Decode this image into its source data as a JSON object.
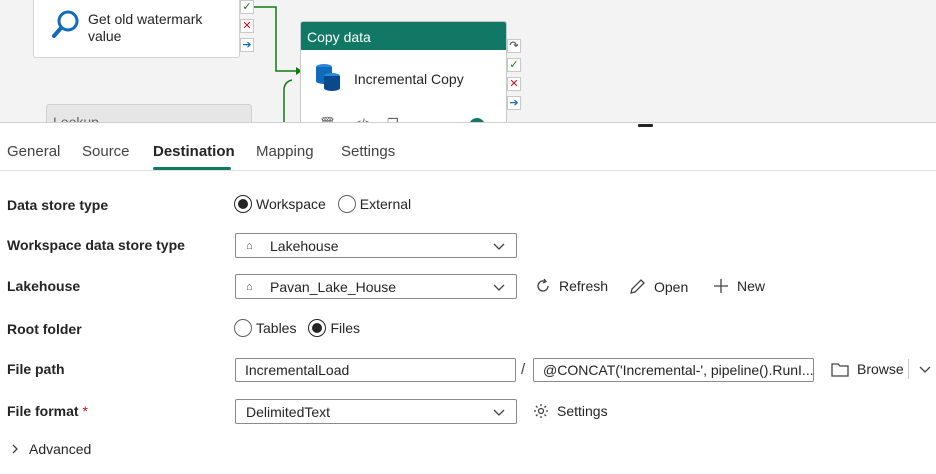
{
  "canvas": {
    "lookup_activity_label": "Get old watermark value",
    "lookup_partial_label": "Lookup",
    "copy_activity": {
      "header": "Copy data",
      "name": "Incremental Copy",
      "header_color": "#117865"
    },
    "status_icons": [
      "success-check-icon",
      "failure-x-icon",
      "completion-arrow-icon",
      "skip-icon"
    ]
  },
  "tabs": [
    {
      "label": "General",
      "active": false
    },
    {
      "label": "Source",
      "active": false
    },
    {
      "label": "Destination",
      "active": true
    },
    {
      "label": "Mapping",
      "active": false
    },
    {
      "label": "Settings",
      "active": false
    }
  ],
  "form": {
    "data_store_type": {
      "label": "Data store type",
      "options": [
        {
          "label": "Workspace",
          "selected": true
        },
        {
          "label": "External",
          "selected": false
        }
      ]
    },
    "workspace_data_store_type": {
      "label": "Workspace data store type",
      "value": "Lakehouse",
      "icon": "lakehouse-icon"
    },
    "lakehouse": {
      "label": "Lakehouse",
      "value": "Pavan_Lake_House",
      "icon": "lakehouse-icon",
      "actions": {
        "refresh": "Refresh",
        "open": "Open",
        "new": "New"
      }
    },
    "root_folder": {
      "label": "Root folder",
      "options": [
        {
          "label": "Tables",
          "selected": false
        },
        {
          "label": "Files",
          "selected": true
        }
      ]
    },
    "file_path": {
      "label": "File path",
      "directory": "IncrementalLoad",
      "separator": "/",
      "file_name": "@CONCAT('Incremental-', pipeline().RunI...",
      "browse_label": "Browse"
    },
    "file_format": {
      "label": "File format",
      "required_marker": "*",
      "value": "DelimitedText",
      "settings_label": "Settings"
    },
    "advanced_label": "Advanced"
  },
  "colors": {
    "accent": "#117865",
    "success": "#107c10",
    "error": "#c50f1f",
    "info": "#0f6cbd"
  }
}
